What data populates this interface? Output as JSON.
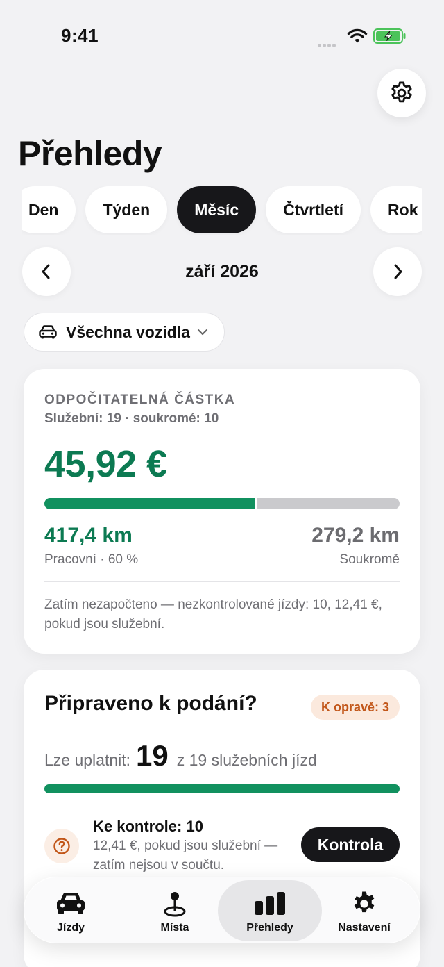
{
  "status": {
    "time": "9:41"
  },
  "page": {
    "title": "Přehledy"
  },
  "period_tabs": [
    {
      "label": "Den",
      "active": false
    },
    {
      "label": "Týden",
      "active": false
    },
    {
      "label": "Měsíc",
      "active": true
    },
    {
      "label": "Čtvrtletí",
      "active": false
    },
    {
      "label": "Rok",
      "active": false
    }
  ],
  "period": {
    "label": "září 2026"
  },
  "vehicle_filter": {
    "label": "Všechna vozidla"
  },
  "deduction": {
    "heading": "ODPOČITATELNÁ ČÁSTKA",
    "subheading": "Služební: 19 · soukromé: 10",
    "amount": "45,92 €",
    "work_share": 0.6,
    "work_km": "417,4 km",
    "work_label": "Pracovní · 60 %",
    "private_km": "279,2 km",
    "private_label": "Soukromě",
    "note": "Zatím nezapočteno — nezkontrolované jízdy: 10, 12,41 €, pokud jsou služební."
  },
  "ready": {
    "title": "Připraveno k podání?",
    "badge": "K opravě: 3",
    "claim_prefix": "Lze uplatnit:",
    "claim_count": "19",
    "claim_suffix": "z 19 služebních jízd",
    "progress": 1.0,
    "review_title": "Ke kontrole: 10",
    "review_desc": "12,41 €, pokud jsou služební — zatím nejsou v součtu.",
    "review_button": "Kontrola"
  },
  "tabbar": [
    {
      "label": "Jízdy",
      "icon": "car-icon",
      "active": false
    },
    {
      "label": "Místa",
      "icon": "map-pin-icon",
      "active": false
    },
    {
      "label": "Přehledy",
      "icon": "bar-chart-icon",
      "active": true
    },
    {
      "label": "Nastavení",
      "icon": "gear-icon",
      "active": false
    }
  ],
  "colors": {
    "accent_green": "#0c7a52",
    "bar_green": "#11915f",
    "warning_orange": "#c2571a",
    "background": "#f2f2f4"
  }
}
